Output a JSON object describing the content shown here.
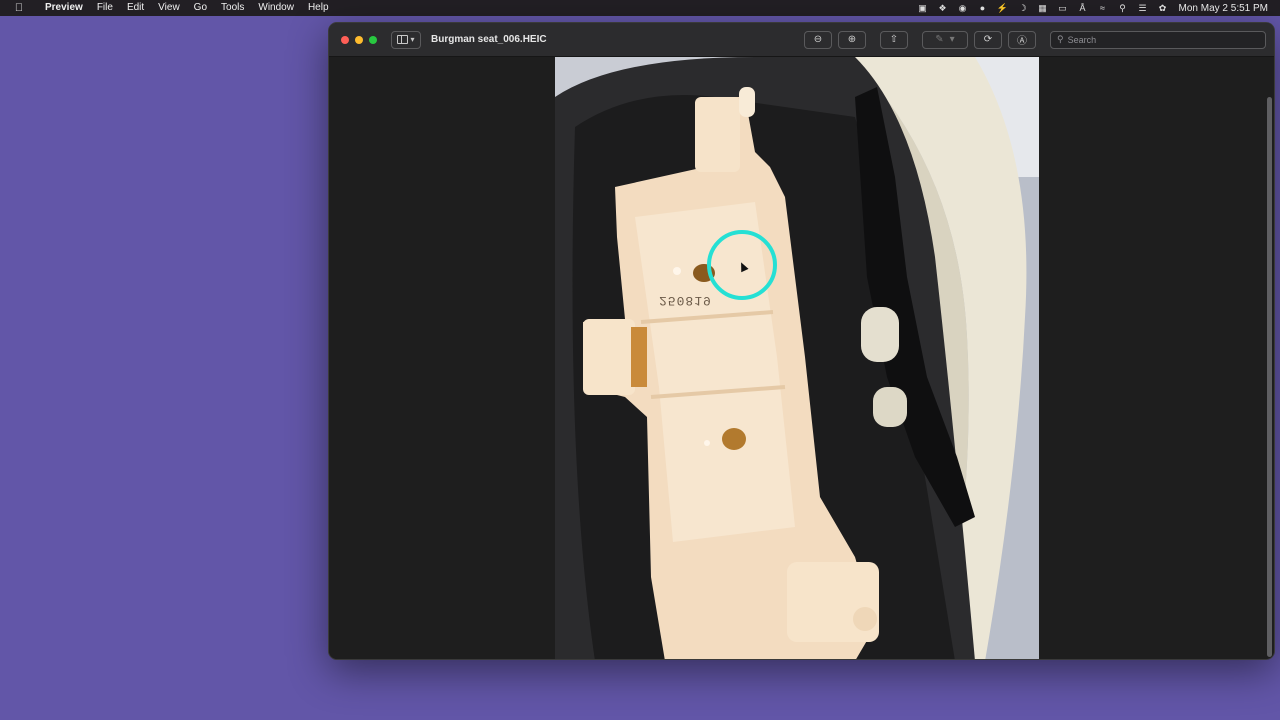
{
  "menubar": {
    "app": "Preview",
    "items": [
      "File",
      "Edit",
      "View",
      "Go",
      "Tools",
      "Window",
      "Help"
    ],
    "clock": "Mon May 2  5:51 PM",
    "status_icons": [
      "screen-record-icon",
      "dropbox-icon",
      "creative-cloud-icon",
      "dot-icon",
      "bolt-icon",
      "moon-icon",
      "keyboard-icon",
      "display-icon",
      "bluetooth-icon",
      "wifi-icon",
      "search-icon",
      "control-center-icon",
      "siri-icon"
    ]
  },
  "window": {
    "title": "Burgman seat_006.HEIC",
    "search_placeholder": "Search",
    "toolbar": [
      "zoom-out-icon",
      "zoom-in-icon",
      "share-icon",
      "markup-pen-icon",
      "rotate-icon",
      "annotate-icon"
    ]
  },
  "photo": {
    "stamped_number": "250819"
  },
  "colors": {
    "desktop": "#6256a8",
    "cursor_highlight": "#25e0d4"
  }
}
